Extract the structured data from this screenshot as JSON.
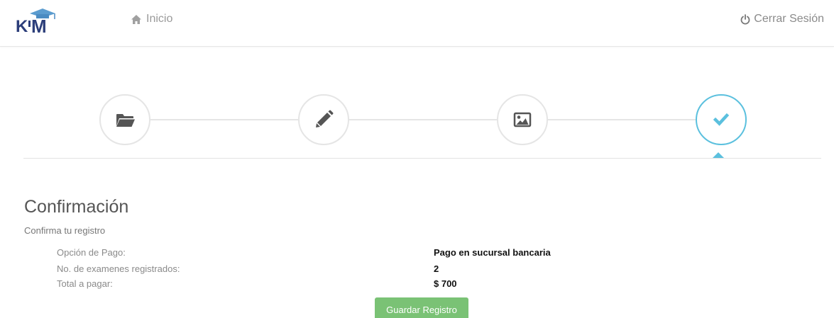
{
  "navbar": {
    "logo_text": "KIM",
    "home_label": "Inicio",
    "logout_label": "Cerrar Sesión"
  },
  "wizard": {
    "steps": [
      {
        "icon": "folder-open-icon",
        "active": false
      },
      {
        "icon": "pencil-icon",
        "active": false
      },
      {
        "icon": "picture-icon",
        "active": false
      },
      {
        "icon": "check-icon",
        "active": true
      }
    ],
    "active_step": 4,
    "colors": {
      "active": "#5bc0de",
      "inactive": "#e5e5e5",
      "icon": "#555555"
    }
  },
  "main": {
    "title": "Confirmación",
    "subtitle": "Confirma tu registro",
    "rows": [
      {
        "label": "Opción de Pago:",
        "value": "Pago en sucursal bancaria"
      },
      {
        "label": "No. de examenes registrados:",
        "value": "2"
      },
      {
        "label": "Total a pagar:",
        "value": "$ 700"
      }
    ],
    "save_label": "Guardar Registro"
  },
  "colors": {
    "save_button": "#7ac275",
    "logo_primary": "#2c3e7a",
    "logo_accent": "#5bc0de"
  }
}
